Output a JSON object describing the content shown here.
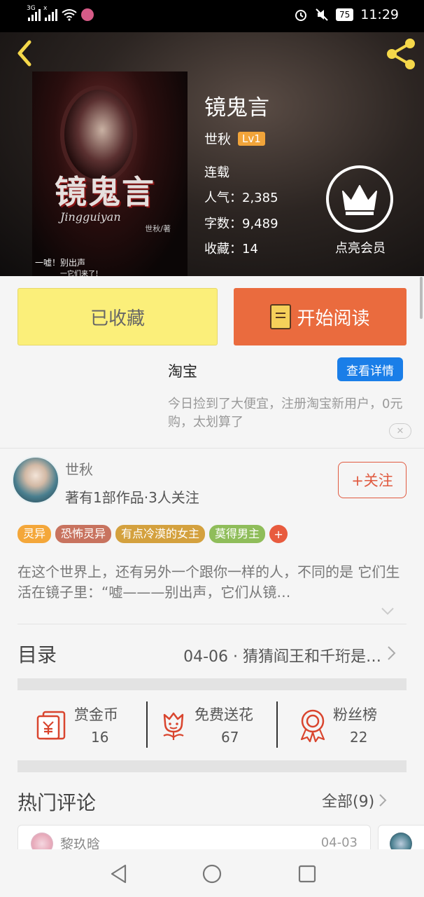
{
  "status_bar": {
    "net1": "3G",
    "net2": "x",
    "battery": "75",
    "time": "11:29"
  },
  "book": {
    "title": "镜鬼言",
    "author": "世秋",
    "level": "Lv1",
    "status": "连载",
    "popularity_label": "人气：",
    "popularity": "2,385",
    "words_label": "字数：",
    "words": "9,489",
    "favorites_label": "收藏：",
    "favorites": "14",
    "cover": {
      "title": "镜鬼言",
      "pinyin": "Jingguiyan",
      "author_line": "世秋/著",
      "line1": "一嘘！别出声",
      "line2": "一它们来了！"
    }
  },
  "vip": {
    "label": "点亮会员"
  },
  "actions": {
    "collected": "已收藏",
    "read": "开始阅读"
  },
  "ad": {
    "title": "淘宝",
    "button": "查看详情",
    "text": "今日捡到了大便宜，注册淘宝新用户，0元购，太划算了",
    "close": "✕"
  },
  "author_section": {
    "name": "世秋",
    "stats": "著有1部作品·3人关注",
    "follow": "+关注"
  },
  "tags": [
    {
      "label": "灵异",
      "color": "#f4a73a"
    },
    {
      "label": "恐怖灵异",
      "color": "#c8735f"
    },
    {
      "label": "有点冷漠的女主",
      "color": "#d4a13e"
    },
    {
      "label": "莫得男主",
      "color": "#8fbd5a"
    }
  ],
  "tag_add": "+",
  "synopsis": "在这个世界上，还有另外一个跟你一样的人，不同的是 它们生活在镜子里：“嘘———别出声，它们从镜…",
  "catalog": {
    "label": "目录",
    "latest": "04-06 · 猜猜阎王和千珩是…"
  },
  "stats": [
    {
      "name": "赏金币",
      "value": "16",
      "icon": "coin-reward-icon"
    },
    {
      "name": "免费送花",
      "value": "67",
      "icon": "flower-icon"
    },
    {
      "name": "粉丝榜",
      "value": "22",
      "icon": "medal-icon"
    }
  ],
  "comments": {
    "title": "热门评论",
    "all": "全部(9)",
    "first": {
      "name": "黎玖晗",
      "date": "04-03"
    }
  },
  "colors": {
    "accent_orange": "#ea6b3e",
    "collected_yellow": "#fbef7a",
    "ad_blue": "#1a7ee8",
    "icon_red": "#d9452e"
  }
}
